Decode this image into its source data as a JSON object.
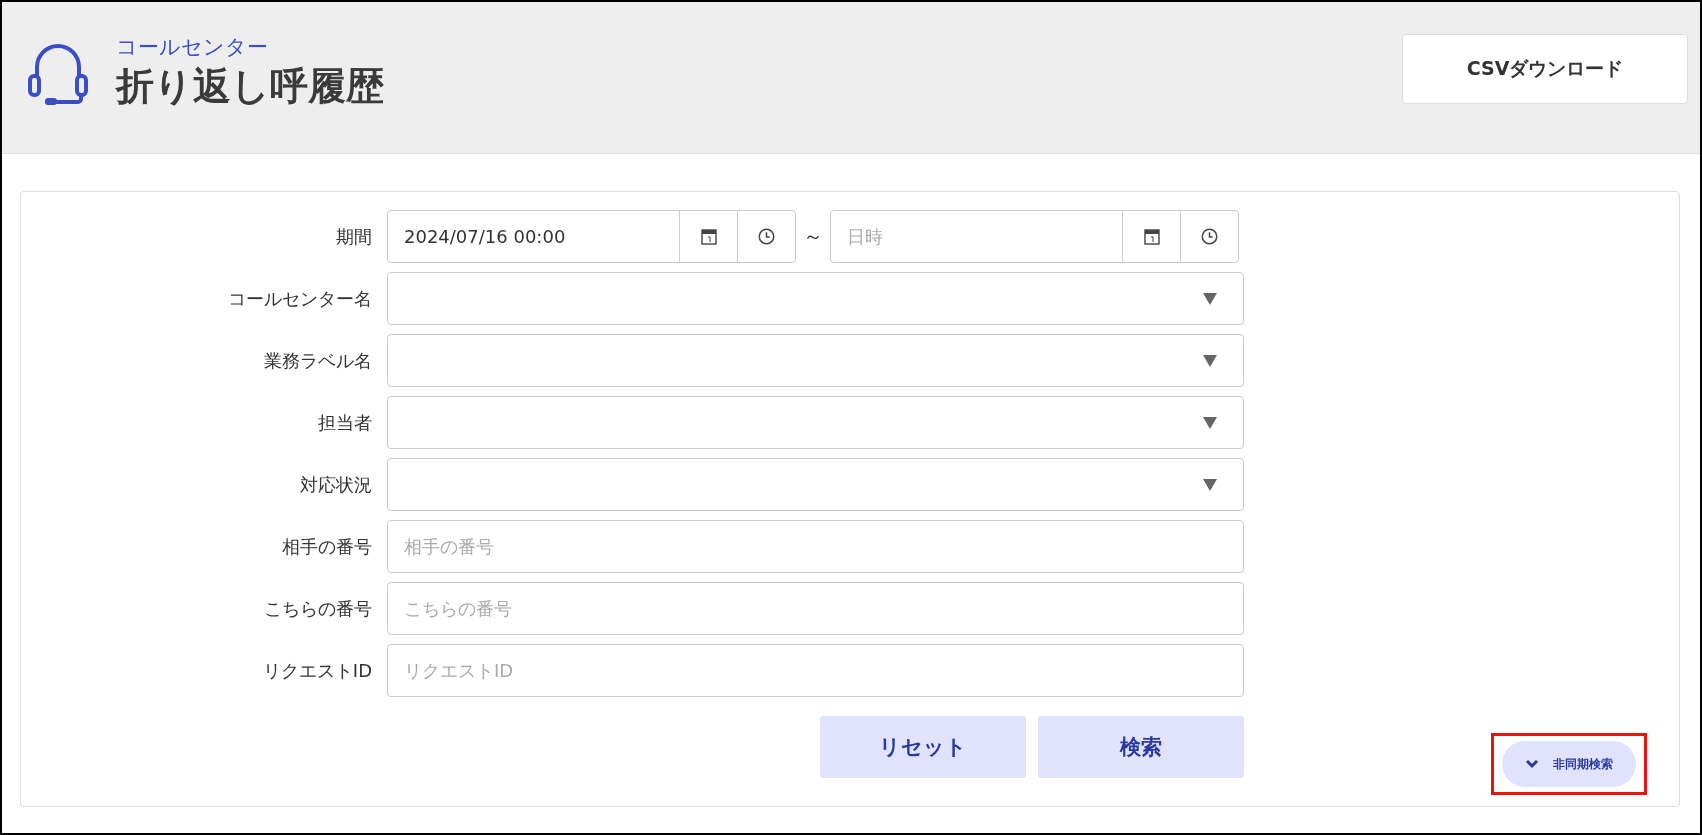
{
  "header": {
    "subtitle": "コールセンター",
    "title": "折り返し呼履歴",
    "csv_button": "CSVダウンロード"
  },
  "form": {
    "fields": [
      {
        "kind": "datetime-range",
        "label": "期間",
        "from_value": "2024/07/16 00:00",
        "separator": "～",
        "to_placeholder": "日時"
      },
      {
        "kind": "select",
        "label": "コールセンター名"
      },
      {
        "kind": "select",
        "label": "業務ラベル名"
      },
      {
        "kind": "select",
        "label": "担当者"
      },
      {
        "kind": "select",
        "label": "対応状況"
      },
      {
        "kind": "text",
        "label": "相手の番号",
        "placeholder": "相手の番号"
      },
      {
        "kind": "text",
        "label": "こちらの番号",
        "placeholder": "こちらの番号"
      },
      {
        "kind": "text",
        "label": "リクエストID",
        "placeholder": "リクエストID"
      }
    ],
    "buttons": [
      "リセット",
      "検索"
    ],
    "async_toggle": {
      "label": "非同期検索",
      "highlighted": true
    }
  }
}
